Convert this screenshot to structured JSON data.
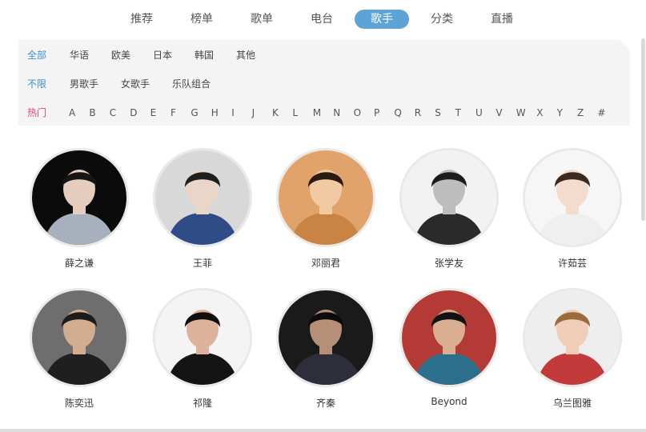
{
  "nav": {
    "tabs": [
      {
        "label": "推荐"
      },
      {
        "label": "榜单"
      },
      {
        "label": "歌单"
      },
      {
        "label": "电台"
      },
      {
        "label": "歌手",
        "active": true
      },
      {
        "label": "分类"
      },
      {
        "label": "直播"
      }
    ],
    "accent_color": "#5ca4d6"
  },
  "filters": {
    "region": {
      "items": [
        "全部",
        "华语",
        "欧美",
        "日本",
        "韩国",
        "其他"
      ],
      "selected": "全部"
    },
    "gender": {
      "items": [
        "不限",
        "男歌手",
        "女歌手",
        "乐队组合"
      ],
      "selected": "不限"
    },
    "index": {
      "hot_label": "热门",
      "letters": [
        "A",
        "B",
        "C",
        "D",
        "E",
        "F",
        "G",
        "H",
        "I",
        "J",
        "K",
        "L",
        "M",
        "N",
        "O",
        "P",
        "Q",
        "R",
        "S",
        "T",
        "U",
        "V",
        "W",
        "X",
        "Y",
        "Z",
        "#"
      ]
    },
    "selected_color": "#3a8fd0",
    "hot_color": "#e0476a"
  },
  "artists": [
    {
      "name": "薛之谦"
    },
    {
      "name": "王菲"
    },
    {
      "name": "邓丽君"
    },
    {
      "name": "张学友"
    },
    {
      "name": "许茹芸"
    },
    {
      "name": "陈奕迅"
    },
    {
      "name": "祁隆"
    },
    {
      "name": "齐秦"
    },
    {
      "name": "Beyond"
    },
    {
      "name": "乌兰图雅"
    }
  ]
}
